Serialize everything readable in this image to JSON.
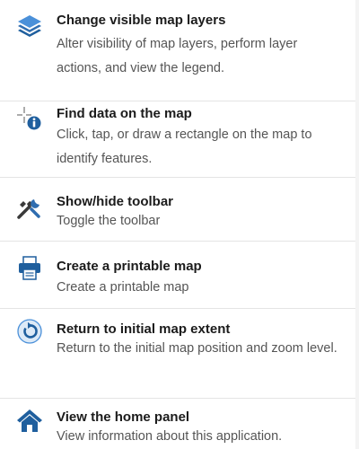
{
  "menu": {
    "items": [
      {
        "icon": "layers-icon",
        "title": "Change visible map layers",
        "description": "Alter visibility of map layers, perform layer actions, and view the legend."
      },
      {
        "icon": "identify-info-icon",
        "title": "Find data on the map",
        "description": "Click, tap, or draw a rectangle on the map to identify features."
      },
      {
        "icon": "tools-icon",
        "title": "Show/hide toolbar",
        "description": "Toggle the toolbar"
      },
      {
        "icon": "printer-icon",
        "title": "Create a printable map",
        "description": "Create a printable map"
      },
      {
        "icon": "reset-extent-icon",
        "title": "Return to initial map extent",
        "description": "Return to the initial map position and zoom level."
      },
      {
        "icon": "home-icon",
        "title": "View the home panel",
        "description": "View information about this application."
      }
    ]
  },
  "colors": {
    "icon_blue": "#1f5f9e",
    "icon_light_blue": "#4a90d9",
    "divider": "#e4e4e4",
    "title_text": "#1b1b1b",
    "desc_text": "#555555"
  }
}
